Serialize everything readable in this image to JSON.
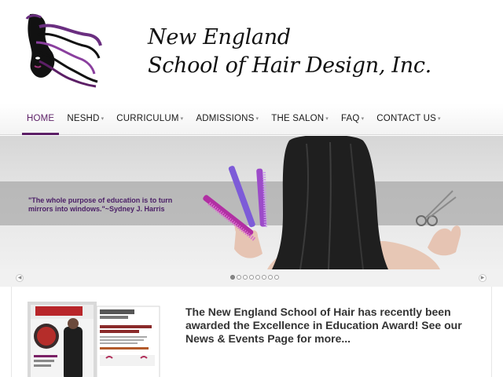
{
  "header": {
    "brand_line1": "New England",
    "brand_line2": "School of Hair Design, Inc."
  },
  "nav": {
    "items": [
      {
        "label": "HOME",
        "caret": ""
      },
      {
        "label": "NESHD",
        "caret": "▾"
      },
      {
        "label": "CURRICULUM",
        "caret": "▾"
      },
      {
        "label": "ADMISSIONS",
        "caret": "▾"
      },
      {
        "label": "THE SALON",
        "caret": "▾"
      },
      {
        "label": "FAQ",
        "caret": "▾"
      },
      {
        "label": "CONTACT US",
        "caret": "▾"
      }
    ],
    "active_index": 0
  },
  "hero": {
    "quote": "\"The whole purpose of education is to turn mirrors into windows.\"~Sydney J. Harris"
  },
  "slider": {
    "prev_icon": "chevron-left-icon",
    "next_icon": "chevron-right-icon",
    "slide_count": 8,
    "active_slide": 1
  },
  "content": {
    "news_text": "The New England School of Hair has recently been awarded the Excellence in Education Award! See our News & Events Page for more..."
  },
  "colors": {
    "accent": "#5c1f66",
    "nav_text": "#1a1a1a",
    "news_text": "#333333"
  }
}
